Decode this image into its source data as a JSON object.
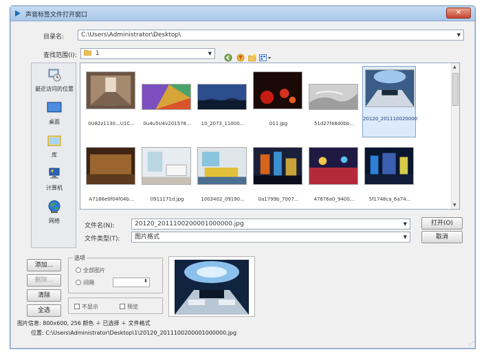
{
  "window": {
    "title": "声音标签文件打开窗口",
    "close_label": "✕"
  },
  "path_row": {
    "label": "目录名:",
    "value": "C:\\Users\\Administrator\\Desktop\\"
  },
  "lookin_row": {
    "label": "查找范围(I):",
    "value": "1"
  },
  "places": [
    {
      "label": "最近访问的位置",
      "icon": "recent-icon"
    },
    {
      "label": "桌面",
      "icon": "desktop-icon"
    },
    {
      "label": "库",
      "icon": "library-icon"
    },
    {
      "label": "计算机",
      "icon": "computer-icon"
    },
    {
      "label": "网络",
      "icon": "network-icon"
    }
  ],
  "files": [
    {
      "name": "0U82z1130...U1C...",
      "selected": false
    },
    {
      "name": "0u4u5U4v201578...",
      "selected": false
    },
    {
      "name": "10_2073_11000...",
      "selected": false
    },
    {
      "name": "011.jpg",
      "selected": false
    },
    {
      "name": "51d27f48d0bb...",
      "selected": false
    },
    {
      "name": "20120_2011100200001000000.jpg",
      "selected": true
    },
    {
      "name": "A7166e0f04f04b...",
      "selected": false
    },
    {
      "name": "0911171d.jpg",
      "selected": false
    },
    {
      "name": "1003402_09190...",
      "selected": false
    },
    {
      "name": "0a1799b_7007...",
      "selected": false
    },
    {
      "name": "47876a0_9400...",
      "selected": false
    },
    {
      "name": "5f1748ca_6a74...",
      "selected": false
    }
  ],
  "filename_row": {
    "label": "文件名(N):",
    "value": "20120_2011100200001000000.jpg"
  },
  "filetype_row": {
    "label": "文件类型(T):",
    "value": "图片格式"
  },
  "buttons": {
    "open": "打开(O)",
    "cancel": "取消",
    "add": "添加...",
    "remove": "删除...",
    "clear": "清除",
    "all": "全选"
  },
  "options": {
    "title": "选项",
    "radio1": "全部图片",
    "radio2": "间隔",
    "check1": "不显示",
    "check2": "预览"
  },
  "info": {
    "line1": "图片信息: 800x600, 256 颜色 ＋ 已选择 ＋ 文件格式",
    "line2": "位置: C:\\Users\\Administrator\\Desktop\\1\\20120_2011100200001000000.jpg"
  }
}
